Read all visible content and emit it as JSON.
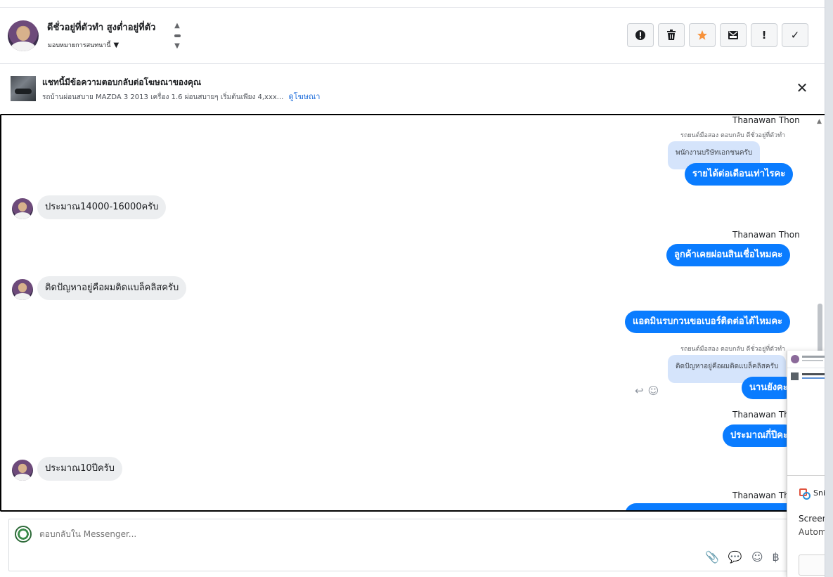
{
  "header": {
    "contact_name": "ดีชั่วอยู่ที่ตัวทำ สูงต่ำอยู่ที่ตัว",
    "assign_label": "มอบหมายการสนทนานี้",
    "actions": [
      {
        "icon": "report-icon",
        "glyph": "❗"
      },
      {
        "icon": "trash-icon",
        "glyph": "🗑"
      },
      {
        "icon": "star-icon",
        "glyph": "★"
      },
      {
        "icon": "archive-mail-icon",
        "glyph": "✉"
      },
      {
        "icon": "exclamation-icon",
        "glyph": "!"
      },
      {
        "icon": "check-icon",
        "glyph": "✓"
      }
    ]
  },
  "ad_banner": {
    "title": "แชทนี้มีข้อความตอบกลับต่อโฆษณาของคุณ",
    "description": "รถบ้านผ่อนสบาย MAZDA 3 2013 เครื่อง 1.6 ผ่อนสบายๆ เริ่มต้นเพียง 4,xxx...",
    "link": "ดูโฆษณา"
  },
  "messages": {
    "sender_name": "Thanawan Thon",
    "reply_label": "รถยนต์มือสอง ตอบกลับ ดีชั่วอยู่ที่ตัวทำ",
    "m1_quote": "พนักงานบริษัทเอกชนครับ",
    "m1_text": "รายได้ต่อเดือนเท่าไรคะ",
    "m2_text": "ประมาณ14000-16000ครับ",
    "m3_text": "ลูกค้าเคยผ่อนสินเชื่อไหมคะ",
    "m4_text": "ติดปัญหาอยู่คือผมติดแบล็คลิสครับ",
    "m5_text": "แอดมินรบกวนขอเบอร์ติดต่อได้ไหมคะ",
    "m6_quote": "ติดปัญหาอยู่คือผมติดแบล็คลิสครับ",
    "m6_text": "นานยังคะ",
    "m7_text": "ประมาณกี่ปีคะ",
    "m8_text": "ประมาณ10ปีครับ",
    "sender_name_partial": "Thanawan Tho",
    "m6_sender_partial": "Thanawan Tho"
  },
  "composer": {
    "placeholder": "ตอบกลับใน Messenger..."
  },
  "notification": {
    "app_name": "Snipp",
    "title": "Screensh",
    "text": "Automat"
  },
  "colors": {
    "outgoing_bubble": "#0a7cff",
    "incoming_bubble": "#eceef0",
    "quote_bubble": "#d5e4fb",
    "star": "#f7923b",
    "link": "#216fdb"
  }
}
